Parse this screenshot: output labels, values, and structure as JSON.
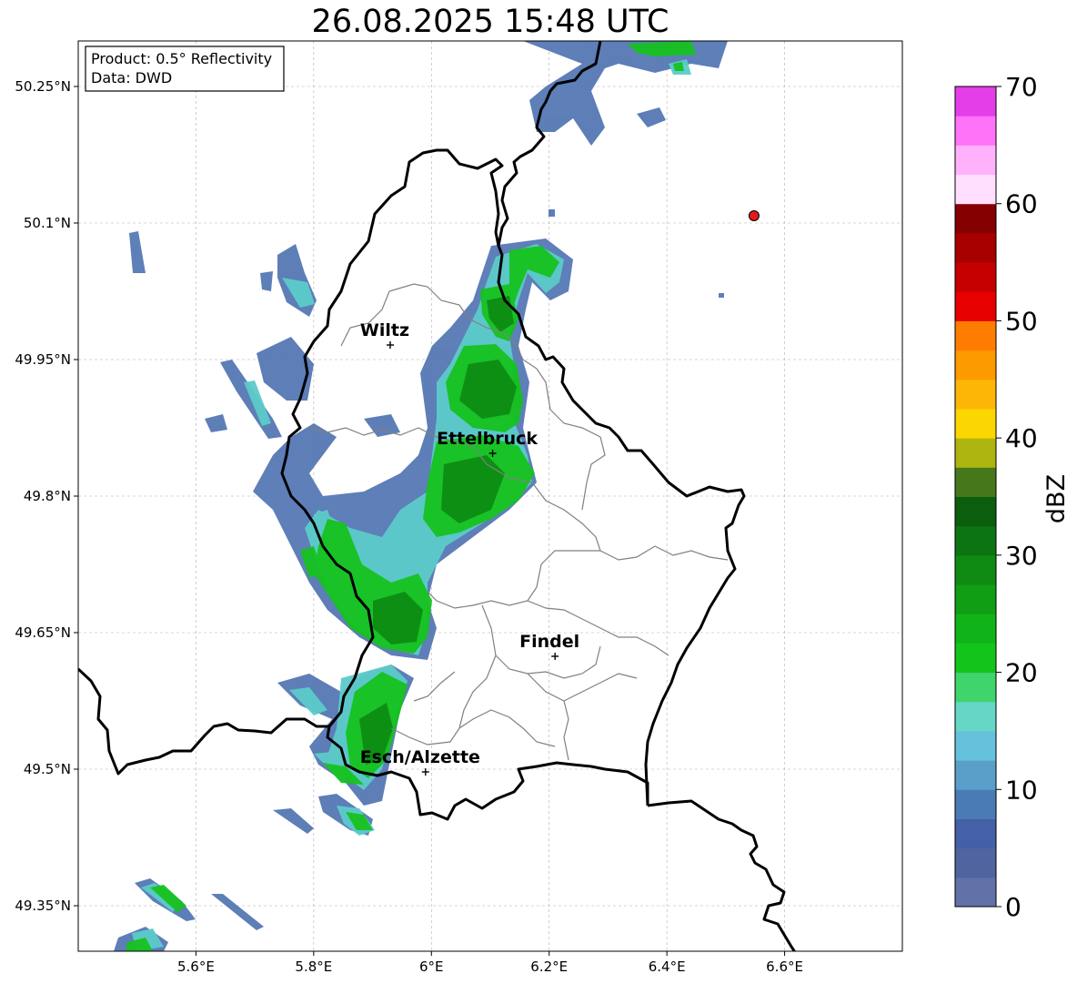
{
  "title": "26.08.2025 15:48 UTC",
  "info_box": {
    "product": "Product: 0.5° Reflectivity",
    "data": "Data: DWD"
  },
  "map": {
    "lon_range": [
      5.4,
      6.8
    ],
    "lat_range": [
      49.3,
      50.3
    ],
    "x_ticks": [
      {
        "lon": 5.6,
        "label": "5.6°E"
      },
      {
        "lon": 5.8,
        "label": "5.8°E"
      },
      {
        "lon": 6.0,
        "label": "6°E"
      },
      {
        "lon": 6.2,
        "label": "6.2°E"
      },
      {
        "lon": 6.4,
        "label": "6.4°E"
      },
      {
        "lon": 6.6,
        "label": "6.6°E"
      }
    ],
    "y_ticks": [
      {
        "lat": 50.25,
        "label": "50.25°N"
      },
      {
        "lat": 50.1,
        "label": "50.1°N"
      },
      {
        "lat": 49.95,
        "label": "49.95°N"
      },
      {
        "lat": 49.8,
        "label": "49.8°N"
      },
      {
        "lat": 49.65,
        "label": "49.65°N"
      },
      {
        "lat": 49.5,
        "label": "49.5°N"
      },
      {
        "lat": 49.35,
        "label": "49.35°N"
      }
    ],
    "cities": [
      {
        "name": "Wiltz",
        "lon": 5.93,
        "lat": 49.966
      },
      {
        "name": "Ettelbruck",
        "lon": 6.104,
        "lat": 49.847
      },
      {
        "name": "Findel",
        "lon": 6.21,
        "lat": 49.624
      },
      {
        "name": "Esch/Alzette",
        "lon": 5.99,
        "lat": 49.497
      }
    ],
    "radar_marker": {
      "lon": 6.548,
      "lat": 50.108,
      "color": "#e31a1c"
    }
  },
  "colorbar": {
    "label": "dBZ",
    "min": 0,
    "max": 70,
    "ticks": [
      0,
      10,
      20,
      30,
      40,
      50,
      60,
      70
    ],
    "colors": [
      "#6272a8",
      "#5064a0",
      "#4460a6",
      "#4b7bb5",
      "#599fc9",
      "#66c2dc",
      "#66d6c6",
      "#3fd46c",
      "#13c51a",
      "#11b418",
      "#109e15",
      "#0e8a12",
      "#0c7410",
      "#0a5e0e",
      "#46771a",
      "#adb40f",
      "#fcd600",
      "#fdb606",
      "#fd9a00",
      "#fe7d00",
      "#e60000",
      "#c60000",
      "#a80000",
      "#850000",
      "#ffdefe",
      "#ffb2fb",
      "#ff73f9",
      "#e43ee8"
    ]
  },
  "legend_colors": {
    "border": "#000000",
    "grid": "#b0b0b0",
    "province": "#808080"
  }
}
